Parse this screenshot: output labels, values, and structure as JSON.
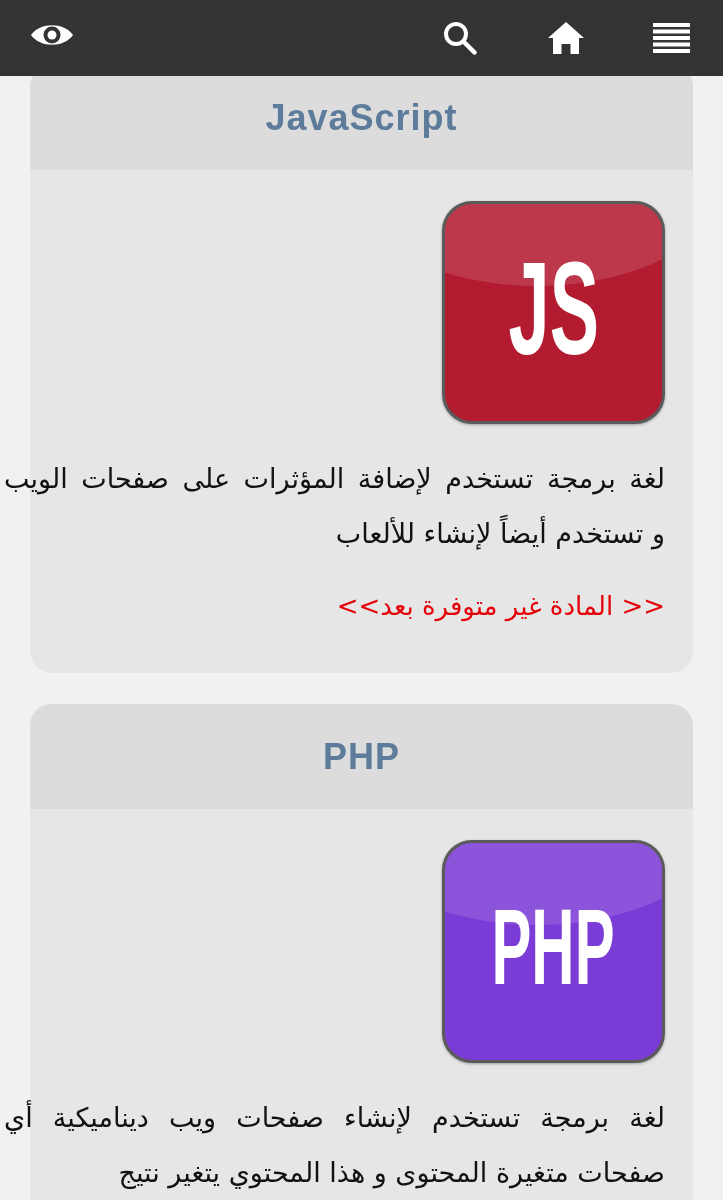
{
  "courses": [
    {
      "title": "JavaScript",
      "logo_text": "JS",
      "color": "#b31b30",
      "description_lines": [
        "لغة برمجة تستخدم لإضافة المؤثرات على صفحات الويب",
        "و تستخدم أيضاً لإنشاء للألعاب"
      ],
      "notice": "<< المادة غير متوفرة بعد>>"
    },
    {
      "title": "PHP",
      "logo_text": "PHP",
      "color": "#7b3bd6",
      "description_lines": [
        "لغة برمجة تستخدم لإنشاء صفحات ويب ديناميكية أي",
        "صفحات متغيرة المحتوى و هذا المحتوي يتغير نتيج"
      ]
    }
  ]
}
